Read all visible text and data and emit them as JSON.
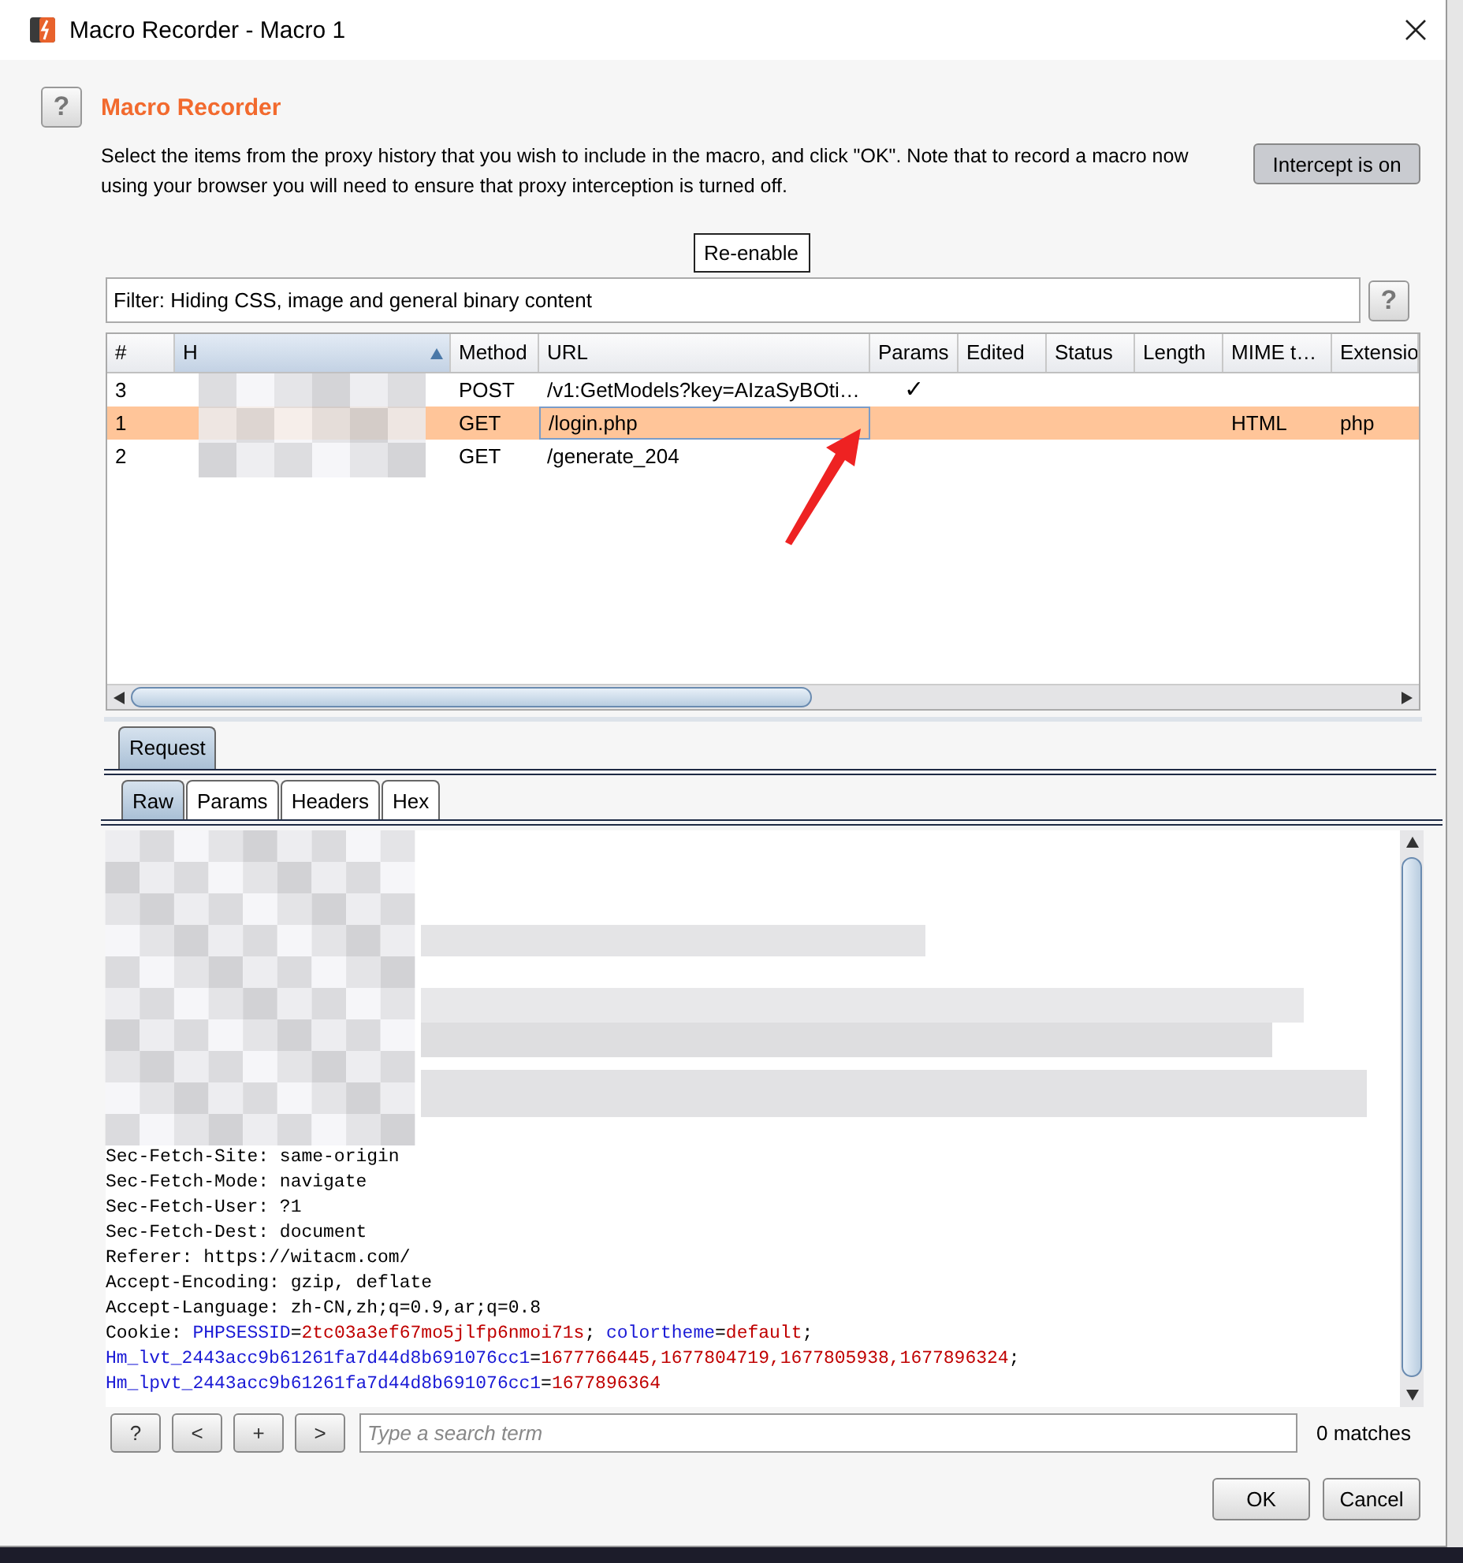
{
  "window": {
    "title": "Macro Recorder - Macro 1"
  },
  "header": {
    "help": "?",
    "title": "Macro Recorder",
    "description": "Select the items from the proxy history that you wish to include in the macro, and click \"OK\". Note that to record a macro now using your browser you will need to ensure that proxy interception is turned off.",
    "intercept_button": "Intercept is on"
  },
  "reenable_button": "Re-enable",
  "filter": {
    "text": "Filter: Hiding CSS, image and general binary content",
    "help": "?"
  },
  "table": {
    "columns": [
      {
        "label": "#",
        "sorted": false
      },
      {
        "label": "H",
        "sorted": true
      },
      {
        "label": "Method",
        "sorted": false
      },
      {
        "label": "URL",
        "sorted": false
      },
      {
        "label": "Params",
        "sorted": false
      },
      {
        "label": "Edited",
        "sorted": false
      },
      {
        "label": "Status",
        "sorted": false
      },
      {
        "label": "Length",
        "sorted": false
      },
      {
        "label": "MIME t…",
        "sorted": false
      },
      {
        "label": "Extensio",
        "sorted": false
      }
    ],
    "rows": [
      {
        "number": "3",
        "method": "POST",
        "url": "/v1:GetModels?key=AIzaSyBOti…",
        "params": "✓",
        "selected": false
      },
      {
        "number": "1",
        "method": "GET",
        "url": "/login.php",
        "mime": "HTML",
        "extension": "php",
        "selected": true
      },
      {
        "number": "2",
        "method": "GET",
        "url": "/generate_204",
        "selected": false
      }
    ]
  },
  "request_tabs": [
    {
      "label": "Request",
      "selected": true
    }
  ],
  "view_tabs": [
    {
      "label": "Raw",
      "selected": true
    },
    {
      "label": "Params",
      "selected": false
    },
    {
      "label": "Headers",
      "selected": false
    },
    {
      "label": "Hex",
      "selected": false
    }
  ],
  "request_lines": [
    [
      {
        "text": "Sec-Fetch-Site: same-origin",
        "kind": "plain"
      }
    ],
    [
      {
        "text": "Sec-Fetch-Mode: navigate",
        "kind": "plain"
      }
    ],
    [
      {
        "text": "Sec-Fetch-User: ?1",
        "kind": "plain"
      }
    ],
    [
      {
        "text": "Sec-Fetch-Dest: document",
        "kind": "plain"
      }
    ],
    [
      {
        "text": "Referer: https://witacm.com/",
        "kind": "plain"
      }
    ],
    [
      {
        "text": "Accept-Encoding: gzip, deflate",
        "kind": "plain"
      }
    ],
    [
      {
        "text": "Accept-Language: zh-CN,zh;q=0.9,ar;q=0.8",
        "kind": "plain"
      }
    ],
    [
      {
        "text": "Cookie: ",
        "kind": "plain"
      },
      {
        "text": "PHPSESSID",
        "kind": "name"
      },
      {
        "text": "=",
        "kind": "plain"
      },
      {
        "text": "2tc03a3ef67mo5jlfp6nmoi71s",
        "kind": "value"
      },
      {
        "text": "; ",
        "kind": "plain"
      },
      {
        "text": "colortheme",
        "kind": "name"
      },
      {
        "text": "=",
        "kind": "plain"
      },
      {
        "text": "default",
        "kind": "value"
      },
      {
        "text": ";",
        "kind": "plain"
      }
    ],
    [
      {
        "text": "Hm_lvt_2443acc9b61261fa7d44d8b691076cc1",
        "kind": "name"
      },
      {
        "text": "=",
        "kind": "plain"
      },
      {
        "text": "1677766445,1677804719,1677805938,1677896324",
        "kind": "value"
      },
      {
        "text": ";",
        "kind": "plain"
      }
    ],
    [
      {
        "text": "Hm_lpvt_2443acc9b61261fa7d44d8b691076cc1",
        "kind": "name"
      },
      {
        "text": "=",
        "kind": "plain"
      },
      {
        "text": "1677896364",
        "kind": "value"
      }
    ]
  ],
  "search": {
    "buttons": [
      "?",
      "<",
      "+",
      ">"
    ],
    "placeholder": "Type a search term",
    "matches": "0 matches"
  },
  "buttons": [
    "OK",
    "Cancel"
  ]
}
